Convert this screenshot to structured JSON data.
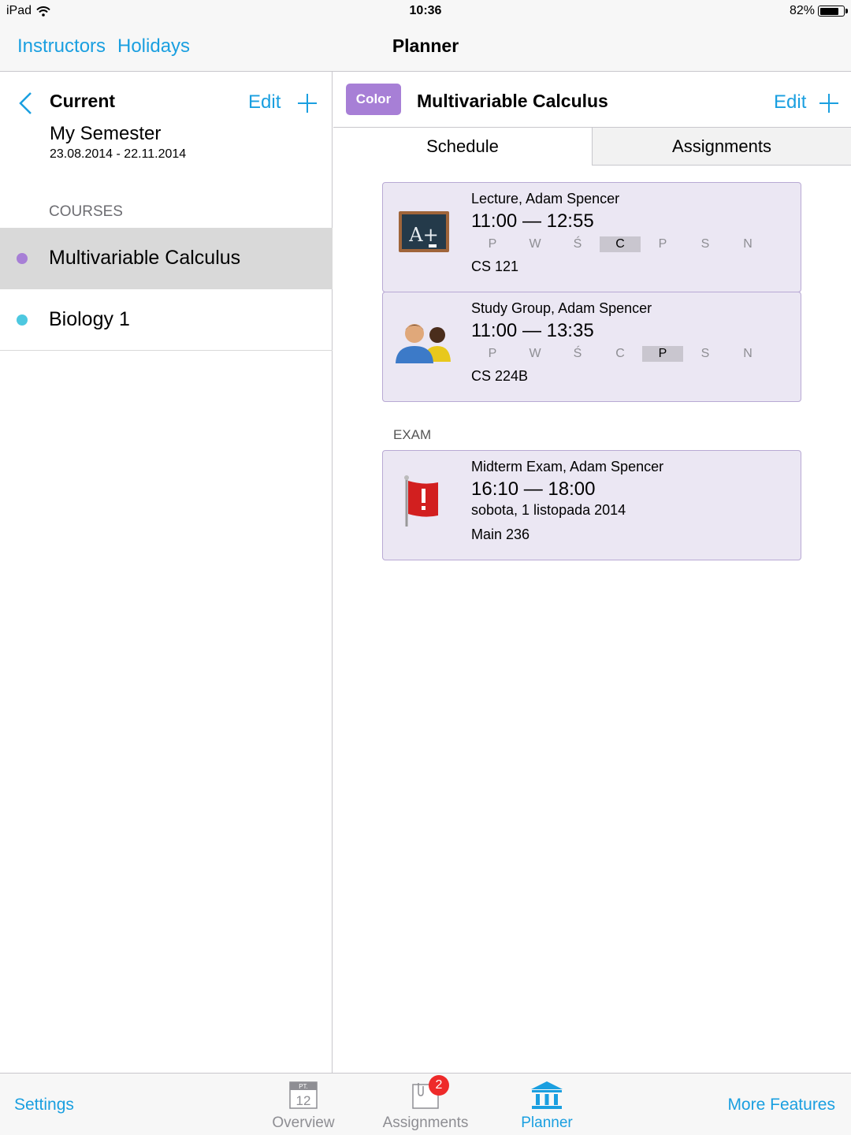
{
  "status_bar": {
    "device": "iPad",
    "time": "10:36",
    "battery": "82%",
    "battery_level": 0.82
  },
  "nav": {
    "left_links": [
      "Instructors",
      "Holidays"
    ],
    "title": "Planner"
  },
  "master": {
    "title": "Current",
    "edit_label": "Edit",
    "semester": {
      "name": "My Semester",
      "dates": "23.08.2014 - 22.11.2014"
    },
    "courses_header": "COURSES",
    "courses": [
      {
        "name": "Multivariable Calculus",
        "color": "#a77fd6",
        "selected": true
      },
      {
        "name": "Biology 1",
        "color": "#4dc8e0",
        "selected": false
      }
    ]
  },
  "detail": {
    "color_button": "Color",
    "title": "Multivariable Calculus",
    "edit_label": "Edit",
    "tabs": [
      "Schedule",
      "Assignments"
    ],
    "classes": [
      {
        "name": "Lecture, Adam Spencer",
        "time": "11:00 — 12:55",
        "days": [
          "P",
          "W",
          "Ś",
          "C",
          "P",
          "S",
          "N"
        ],
        "active_day": 3,
        "room": "CS 121",
        "icon": "chalkboard-icon"
      },
      {
        "name": "Study Group, Adam Spencer",
        "time": "11:00 — 13:35",
        "days": [
          "P",
          "W",
          "Ś",
          "C",
          "P",
          "S",
          "N"
        ],
        "active_day": 4,
        "room": "CS 224B",
        "icon": "people-icon"
      }
    ],
    "exam_header": "EXAM",
    "exams": [
      {
        "name": "Midterm Exam, Adam Spencer",
        "time": "16:10 — 18:00",
        "date": "sobota, 1 listopada 2014",
        "room": "Main 236",
        "icon": "red-flag-icon"
      }
    ]
  },
  "tab_bar": {
    "settings": "Settings",
    "more": "More Features",
    "items": [
      {
        "label": "Overview",
        "icon": "calendar-icon",
        "icon_text_top": "PT.",
        "icon_text_day": "12"
      },
      {
        "label": "Assignments",
        "icon": "assignments-icon",
        "badge": "2"
      },
      {
        "label": "Planner",
        "icon": "planner-building-icon",
        "active": true
      }
    ]
  },
  "colors": {
    "accent": "#1a9fe0",
    "card_bg": "#ebe7f3",
    "card_border": "#b8a9d4",
    "badge": "#ee2a2a"
  }
}
